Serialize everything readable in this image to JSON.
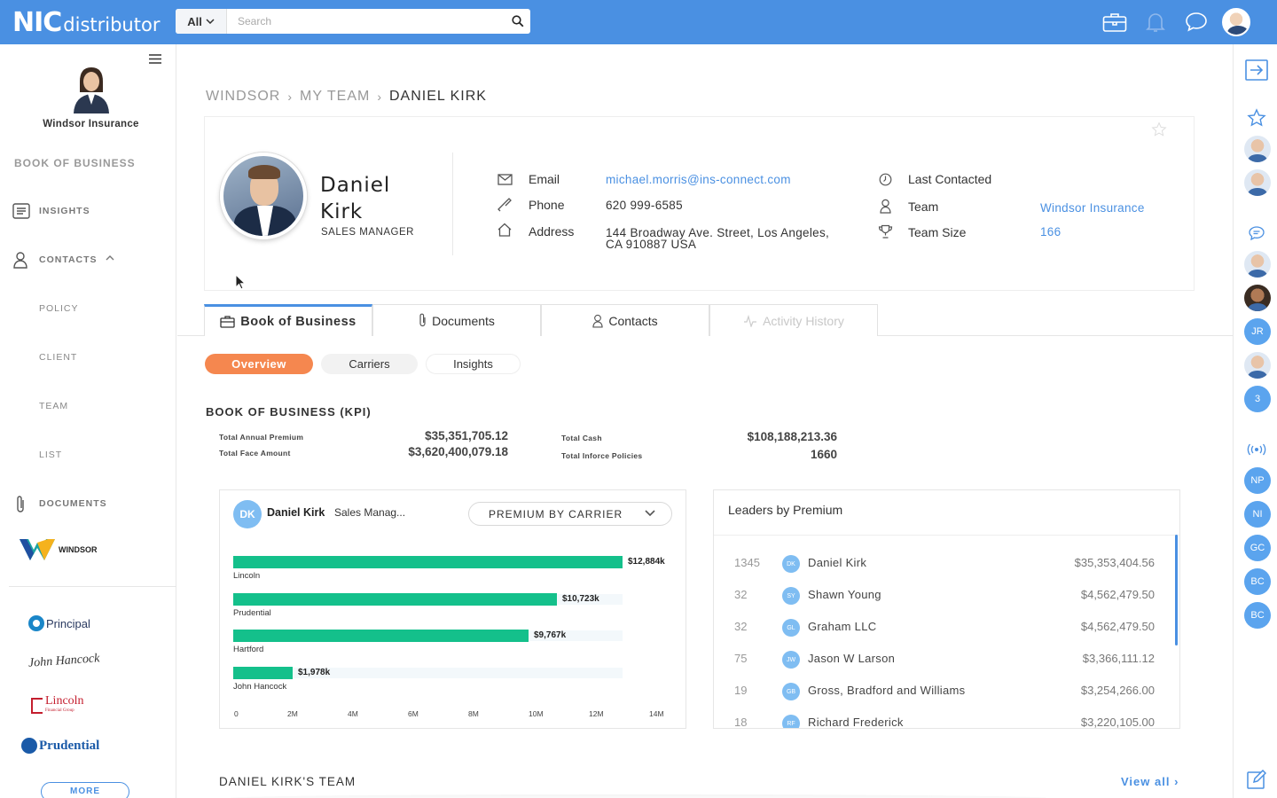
{
  "header": {
    "logo_main": "NIC",
    "logo_sub": "distributor",
    "search_scope": "All",
    "search_placeholder": "Search",
    "icons": [
      "briefcase-icon",
      "bell-icon",
      "chat-icon",
      "user-avatar"
    ]
  },
  "sidebar": {
    "company": "Windsor Insurance",
    "book_of_business": "BOOK OF BUSINESS",
    "items": [
      {
        "label": "INSIGHTS"
      },
      {
        "label": "CONTACTS"
      },
      {
        "label": "POLICY"
      },
      {
        "label": "CLIENT"
      },
      {
        "label": "TEAM"
      },
      {
        "label": "LIST"
      },
      {
        "label": "DOCUMENTS"
      }
    ],
    "brand": "WINDSOR",
    "carriers": [
      "Principal",
      "John Hancock",
      "Lincoln",
      "Financial Group",
      "Prudential"
    ],
    "more": "MORE"
  },
  "breadcrumb": {
    "items": [
      "WINDSOR",
      "MY TEAM",
      "DANIEL KIRK"
    ]
  },
  "profile": {
    "first_name": "Daniel",
    "last_name": "Kirk",
    "title": "SALES MANAGER",
    "email_label": "Email",
    "email": "michael.morris@ins-connect.com",
    "phone_label": "Phone",
    "phone": "620 999-6585",
    "address_label": "Address",
    "address_line1": "144 Broadway Ave. Street, Los Angeles,",
    "address_line2": "CA 910887 USA",
    "last_contacted_label": "Last Contacted",
    "team_label": "Team",
    "team": "Windsor Insurance",
    "team_size_label": "Team Size",
    "team_size": "166"
  },
  "tabs": [
    {
      "label": "Book of Business",
      "active": true
    },
    {
      "label": "Documents"
    },
    {
      "label": "Contacts"
    },
    {
      "label": "Activity History",
      "disabled": true
    }
  ],
  "subtabs": [
    "Overview",
    "Carriers",
    "Insights"
  ],
  "kpi": {
    "title": "BOOK OF BUSINESS (KPI)",
    "total_annual_premium_label": "Total Annual Premium",
    "total_annual_premium": "$35,351,705.12",
    "total_face_amount_label": "Total Face Amount",
    "total_face_amount": "$3,620,400,079.18",
    "total_cash_label": "Total Cash",
    "total_cash": "$108,188,213.36",
    "total_inforce_label": "Total Inforce Policies",
    "total_inforce": "1660"
  },
  "chart_card": {
    "initials": "DK",
    "name": "Daniel Kirk",
    "role": "Sales Manag...",
    "select": "PREMIUM BY CARRIER"
  },
  "chart_data": {
    "type": "bar",
    "orientation": "horizontal",
    "categories": [
      "Lincoln",
      "Prudential",
      "Hartford",
      "John Hancock"
    ],
    "values": [
      12884,
      10723,
      9767,
      1978
    ],
    "value_labels": [
      "$12,884k",
      "$10,723k",
      "$9,767k",
      "$1,978k"
    ],
    "xticks": [
      "0",
      "2M",
      "4M",
      "6M",
      "8M",
      "10M",
      "12M",
      "14M"
    ],
    "xlim": [
      0,
      14000
    ],
    "bar_color": "#14c08b"
  },
  "leaders": {
    "title": "Leaders by Premium",
    "rows": [
      {
        "num": "1345",
        "initials": "DK",
        "name": "Daniel Kirk",
        "amount": "$35,353,404.56"
      },
      {
        "num": "32",
        "initials": "SY",
        "name": "Shawn Young",
        "amount": "$4,562,479.50"
      },
      {
        "num": "32",
        "initials": "GL",
        "name": "Graham LLC",
        "amount": "$4,562,479.50"
      },
      {
        "num": "75",
        "initials": "JW",
        "name": "Jason W Larson",
        "amount": "$3,366,111.12"
      },
      {
        "num": "19",
        "initials": "GB",
        "name": "Gross, Bradford and Williams",
        "amount": "$3,254,266.00"
      },
      {
        "num": "18",
        "initials": "RF",
        "name": "Richard Frederick",
        "amount": "$3,220,105.00"
      }
    ]
  },
  "team_section": {
    "title": "DANIEL KIRK'S TEAM",
    "view_all": "View all"
  },
  "rail": {
    "badges": [
      "JR",
      "3",
      "NP",
      "NI",
      "GC",
      "BC",
      "BC"
    ]
  },
  "colors": {
    "primary": "#4a90e2",
    "accent": "#f5874f",
    "bar": "#14c08b"
  }
}
